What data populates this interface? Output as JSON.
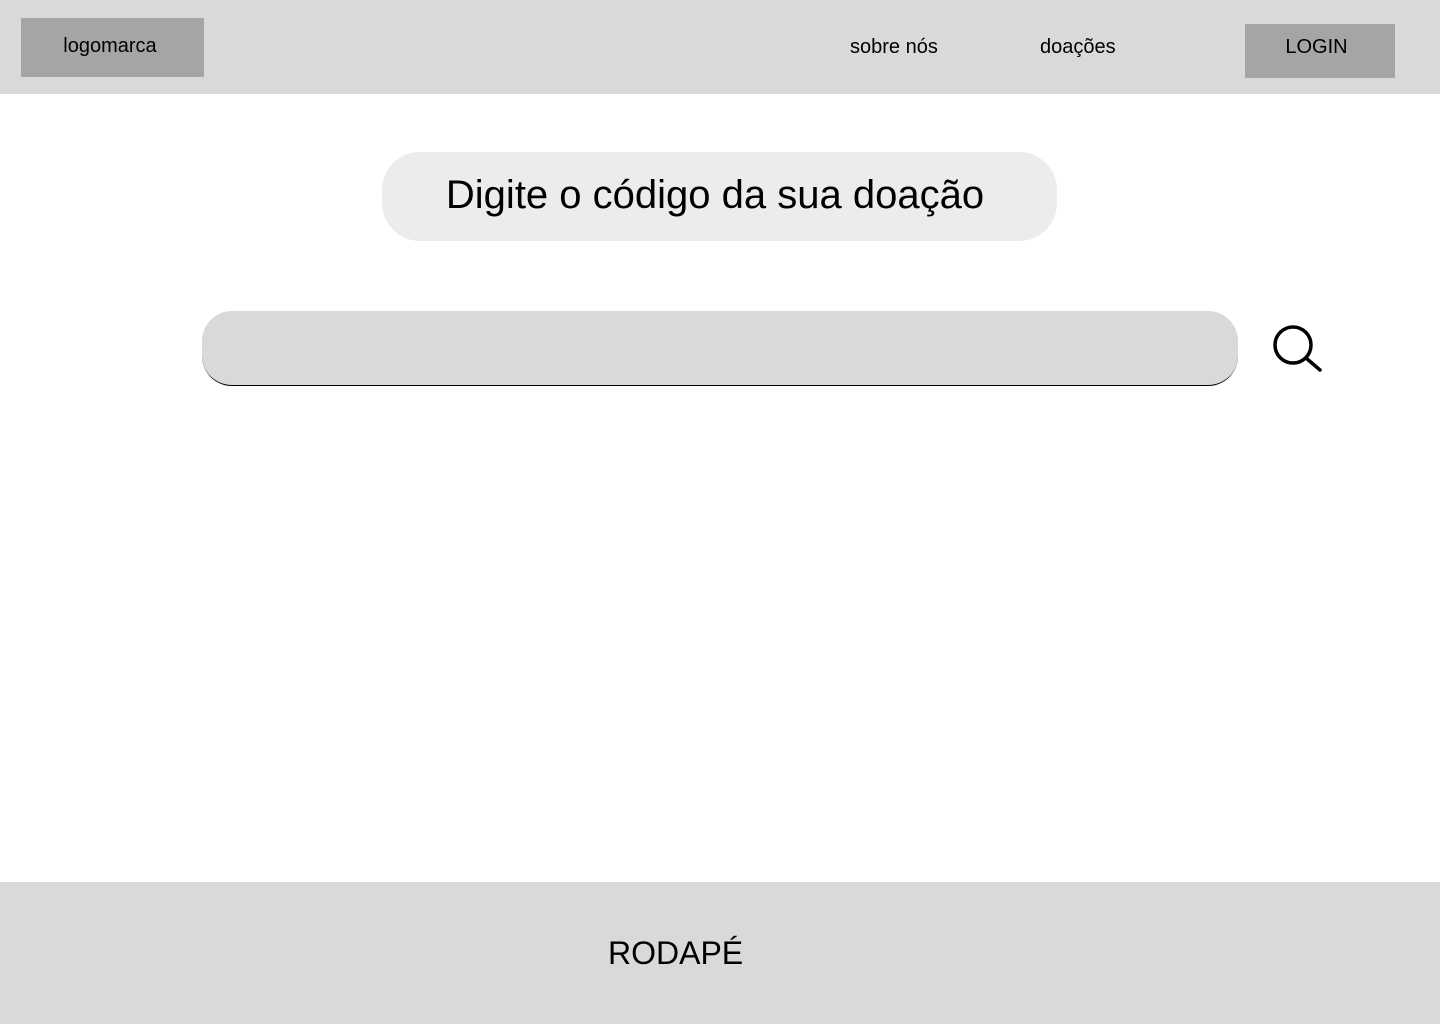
{
  "colors": {
    "header_bg": "#d9d9d9",
    "placeholder_box": "#a6a5a5",
    "prompt_bg": "#ececec",
    "input_bg": "#d9d9d9",
    "footer_bg": "#d9d9d9",
    "text": "#000000"
  },
  "header": {
    "logo_label": "logomarca",
    "nav": {
      "about": "sobre nós",
      "donations": "doações"
    },
    "login_label": "LOGIN"
  },
  "main": {
    "prompt": "Digite o código da sua doação",
    "search": {
      "value": "",
      "icon": "search-icon"
    }
  },
  "footer": {
    "label": "RODAPÉ"
  }
}
